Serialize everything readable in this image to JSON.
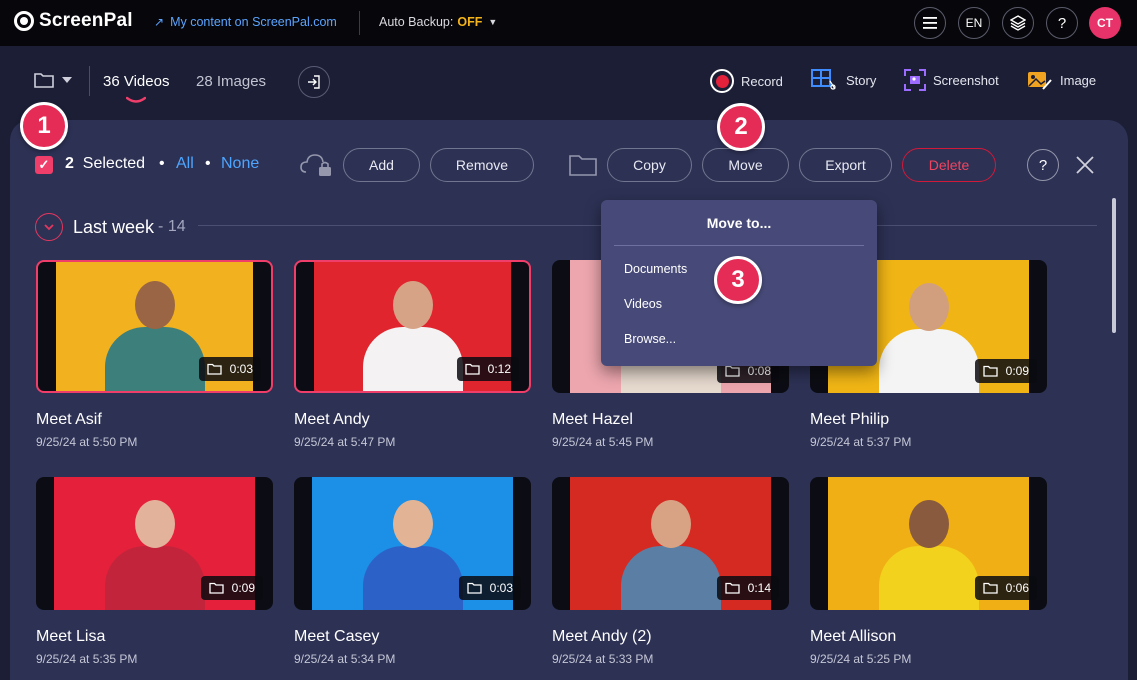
{
  "topbar": {
    "logo_text": "ScreenPal",
    "my_content_prefix": "My content on ",
    "my_content_brand": "ScreenPal.com",
    "auto_backup_label": "Auto Backup: ",
    "auto_backup_value": "OFF",
    "lang": "EN",
    "help": "?",
    "avatar_initials": "CT"
  },
  "library": {
    "videos_tab": "36 Videos",
    "images_tab": "28 Images"
  },
  "tools": {
    "record": "Record",
    "story": "Story",
    "screenshot": "Screenshot",
    "image": "Image"
  },
  "selection": {
    "count": "2",
    "label": "Selected",
    "dot": "•",
    "all": "All",
    "none": "None",
    "add": "Add",
    "remove": "Remove",
    "copy": "Copy",
    "move": "Move",
    "export": "Export",
    "delete": "Delete",
    "help": "?"
  },
  "section": {
    "title": "Last week",
    "count": " - 14"
  },
  "move_menu": {
    "title": "Move to...",
    "items": [
      "Documents",
      "Videos",
      "Browse..."
    ]
  },
  "steps": [
    "1",
    "2",
    "3"
  ],
  "videos": [
    {
      "title": "Meet Asif",
      "date": "9/25/24 at 5:50 PM",
      "duration": "0:03",
      "bg": "#f2b11e",
      "shirt": "#3d7f7a",
      "skin": "#9a6544",
      "selected": true
    },
    {
      "title": "Meet Andy",
      "date": "9/25/24 at 5:47 PM",
      "duration": "0:12",
      "bg": "#e0252e",
      "shirt": "#f4f2f2",
      "skin": "#d7a387",
      "selected": true
    },
    {
      "title": "Meet Hazel",
      "date": "9/25/24 at 5:45 PM",
      "duration": "0:08",
      "bg": "#eda6ae",
      "shirt": "#e6d9ce",
      "skin": "#e0b39a",
      "selected": false
    },
    {
      "title": "Meet Philip",
      "date": "9/25/24 at 5:37 PM",
      "duration": "0:09",
      "bg": "#f0b515",
      "shirt": "#f4f4f4",
      "skin": "#d29f7e",
      "selected": false
    },
    {
      "title": "Meet Lisa",
      "date": "9/25/24 at 5:35 PM",
      "duration": "0:09",
      "bg": "#e5203b",
      "shirt": "#c2253b",
      "skin": "#e3b29a",
      "selected": false
    },
    {
      "title": "Meet Casey",
      "date": "9/25/24 at 5:34 PM",
      "duration": "0:03",
      "bg": "#1c8fe6",
      "shirt": "#2c62c8",
      "skin": "#e2b495",
      "selected": false
    },
    {
      "title": "Meet Andy (2)",
      "date": "9/25/24 at 5:33 PM",
      "duration": "0:14",
      "bg": "#d42a22",
      "shirt": "#5b7fa4",
      "skin": "#d8a385",
      "selected": false
    },
    {
      "title": "Meet Allison",
      "date": "9/25/24 at 5:25 PM",
      "duration": "0:06",
      "bg": "#f0b015",
      "shirt": "#f2d21d",
      "skin": "#8a5a3e",
      "selected": false
    }
  ]
}
